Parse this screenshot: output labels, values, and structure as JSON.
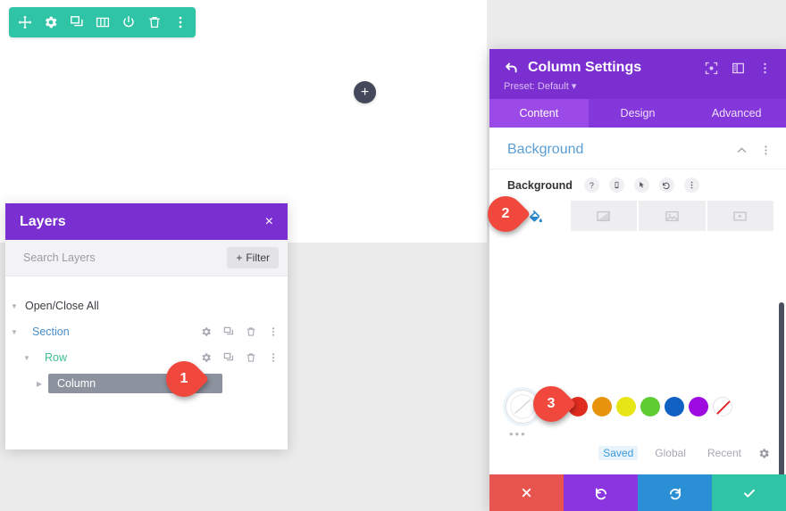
{
  "canvas": {
    "add_button_label": "+",
    "module_toolbar": {
      "icons": [
        {
          "name": "move-icon",
          "label": "Move"
        },
        {
          "name": "gear-icon",
          "label": "Settings"
        },
        {
          "name": "duplicate-icon",
          "label": "Duplicate"
        },
        {
          "name": "columns-icon",
          "label": "Columns"
        },
        {
          "name": "power-icon",
          "label": "Disable"
        },
        {
          "name": "trash-icon",
          "label": "Delete"
        },
        {
          "name": "kebab-menu-icon",
          "label": "More Options"
        }
      ],
      "background_color": "#2ec4a5"
    }
  },
  "layers_panel": {
    "title": "Layers",
    "close_label": "×",
    "search": {
      "placeholder": "Search Layers",
      "value": ""
    },
    "filter_button": "Filter",
    "filter_plus": "+",
    "open_close_all": "Open/Close All",
    "header_color": "#7a2fd1",
    "rows": [
      {
        "label": "Section",
        "level": 0,
        "color": "#4a8dc9",
        "selected": false
      },
      {
        "label": "Row",
        "level": 1,
        "color": "#3dbb94",
        "selected": false
      },
      {
        "label": "Column",
        "level": 2,
        "color": "#ffffff",
        "selected": true
      }
    ],
    "row_actions": [
      "gear-icon",
      "duplicate-icon",
      "trash-icon",
      "kebab-menu-icon"
    ]
  },
  "settings_modal": {
    "title": "Column Settings",
    "preset": "Preset: Default",
    "preset_caret": "▾",
    "header_color": "#7b2fd1",
    "header_icons": [
      "focus-icon",
      "layout-split-icon",
      "kebab-menu-icon"
    ],
    "tabs": [
      {
        "label": "Content",
        "active": true
      },
      {
        "label": "Design",
        "active": false
      },
      {
        "label": "Advanced",
        "active": false
      }
    ],
    "background_section": {
      "title": "Background",
      "collapse_icon": "chevron-up-icon",
      "more_icon": "kebab-menu-icon",
      "field_label": "Background",
      "field_icons": [
        {
          "name": "help-icon",
          "glyph": "?"
        },
        {
          "name": "responsive-phone-icon",
          "glyph": ""
        },
        {
          "name": "hover-cursor-icon",
          "glyph": ""
        },
        {
          "name": "reset-undo-icon",
          "glyph": ""
        },
        {
          "name": "kebab-menu-icon",
          "glyph": ""
        }
      ],
      "type_tabs": [
        {
          "name": "background-color-tab",
          "icon": "paint-bucket-icon",
          "active": true
        },
        {
          "name": "background-gradient-tab",
          "icon": "gradient-icon",
          "active": false
        },
        {
          "name": "background-image-tab",
          "icon": "image-icon",
          "active": false
        },
        {
          "name": "background-video-tab",
          "icon": "video-icon",
          "active": false
        }
      ]
    },
    "color_picker": {
      "current_swatch": "none",
      "more_dots": "•••",
      "swatches": [
        {
          "name": "swatch-white",
          "hex": "#ffffff"
        },
        {
          "name": "swatch-red",
          "hex": "#e02b20"
        },
        {
          "name": "swatch-orange",
          "hex": "#e8930d"
        },
        {
          "name": "swatch-yellow",
          "hex": "#e8e516"
        },
        {
          "name": "swatch-green",
          "hex": "#5fcc33"
        },
        {
          "name": "swatch-blue",
          "hex": "#1161c4"
        },
        {
          "name": "swatch-purple",
          "hex": "#9d0be0"
        },
        {
          "name": "swatch-transparent",
          "hex": "transparent"
        }
      ],
      "palette_tabs": [
        {
          "label": "Saved",
          "active": true
        },
        {
          "label": "Global",
          "active": false
        },
        {
          "label": "Recent",
          "active": false
        }
      ],
      "settings_icon": "gear-icon"
    },
    "footer_buttons": [
      {
        "name": "cancel-button",
        "icon": "close-x-icon",
        "color": "#e8544e"
      },
      {
        "name": "undo-button",
        "icon": "undo-icon",
        "color": "#8b35e0"
      },
      {
        "name": "redo-button",
        "icon": "redo-icon",
        "color": "#2b8fd6"
      },
      {
        "name": "save-button",
        "icon": "checkmark-icon",
        "color": "#2ec4a5"
      }
    ]
  },
  "markers": [
    {
      "number": "1",
      "target": "column-row-gear"
    },
    {
      "number": "2",
      "target": "background-color-tab"
    },
    {
      "number": "3",
      "target": "current-color-swatch"
    }
  ]
}
